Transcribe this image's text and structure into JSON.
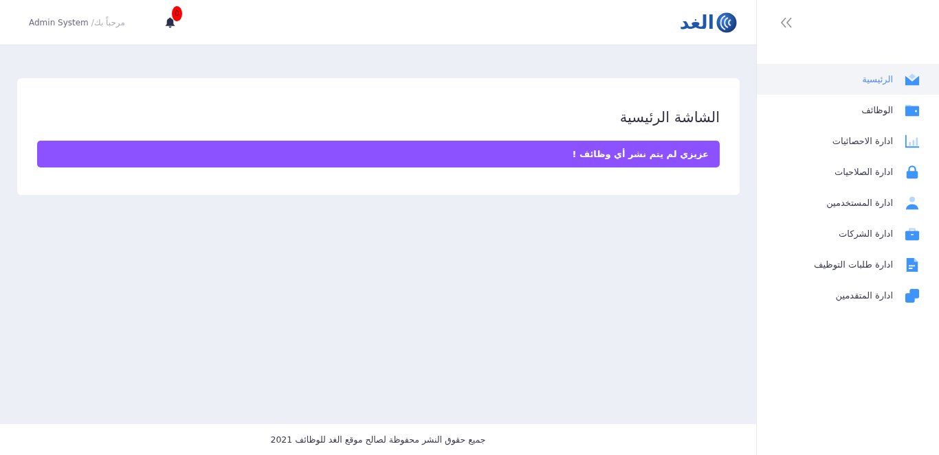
{
  "header": {
    "logo_text": "الغد",
    "notification_count": "0",
    "greeting": "مرحباً بك/",
    "user_name": "Admin System"
  },
  "sidebar": {
    "items": [
      {
        "label": "الرئيسية",
        "selected": true
      },
      {
        "label": "الوظائف",
        "selected": false
      },
      {
        "label": "ادارة الاحصائيات",
        "selected": false
      },
      {
        "label": "ادارة الصلاحيات",
        "selected": false
      },
      {
        "label": "ادارة المستخدمين",
        "selected": false
      },
      {
        "label": "ادارة الشركات",
        "selected": false
      },
      {
        "label": "ادارة طلبات التوظيف",
        "selected": false
      },
      {
        "label": "ادارة المتقدمين",
        "selected": false
      }
    ]
  },
  "page": {
    "title": "الشاشة الرئيسية",
    "alert": "عزيزي لم يتم نشر أي وظائف !"
  },
  "footer": {
    "text": "جميع حقوق النشر محفوظة لصالح موقع الغد للوظائف 2021"
  }
}
